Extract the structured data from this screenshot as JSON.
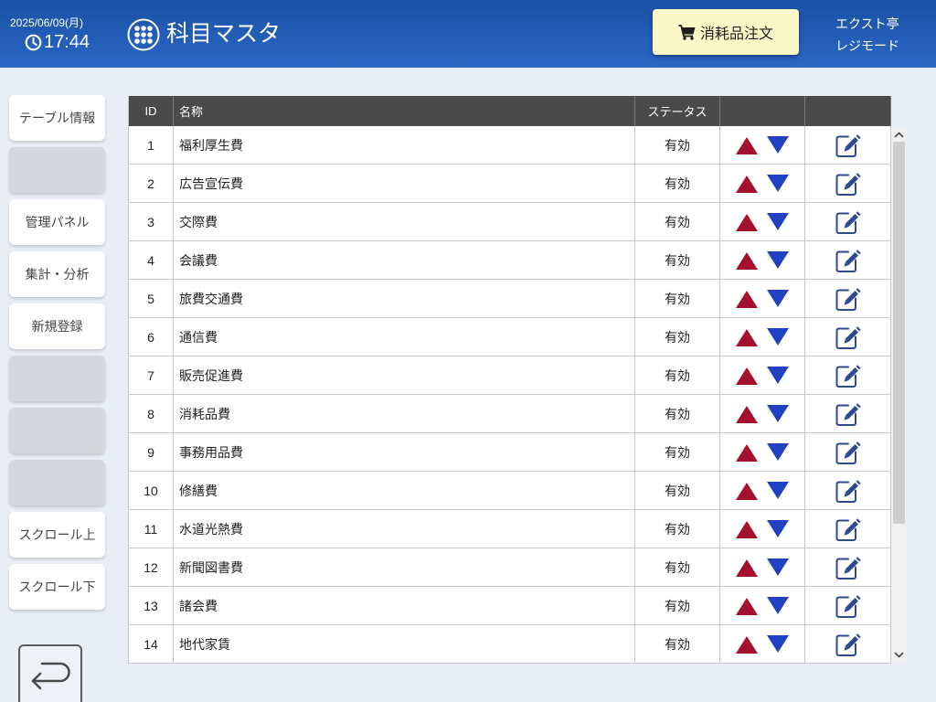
{
  "header": {
    "date": "2025/06/09(月)",
    "time": "17:44",
    "title": "科目マスタ",
    "order_button": {
      "label": "消耗品注文",
      "icon": "cart-icon"
    },
    "store_name": "エクスト亭",
    "mode": "レジモード",
    "clock_icon": "clock-icon",
    "menu_icon": "grid-menu-icon"
  },
  "sidebar": {
    "items": [
      {
        "label": "テーブル情報"
      },
      {
        "label": ""
      },
      {
        "label": "管理パネル"
      },
      {
        "label": "集計・分析"
      },
      {
        "label": "新規登録"
      },
      {
        "label": ""
      },
      {
        "label": ""
      },
      {
        "label": ""
      },
      {
        "label": "スクロール上"
      },
      {
        "label": "スクロール下"
      }
    ],
    "back_button_icon": "return-arrow-icon"
  },
  "table": {
    "columns": {
      "id": "ID",
      "name": "名称",
      "status": "ステータス"
    },
    "row_icons": {
      "move_up": "triangle-up-icon",
      "move_down": "triangle-down-icon",
      "edit": "edit-icon"
    },
    "rows": [
      {
        "id": "1",
        "name": "福利厚生費",
        "status": "有効"
      },
      {
        "id": "2",
        "name": "広告宣伝費",
        "status": "有効"
      },
      {
        "id": "3",
        "name": "交際費",
        "status": "有効"
      },
      {
        "id": "4",
        "name": "会議費",
        "status": "有効"
      },
      {
        "id": "5",
        "name": "旅費交通費",
        "status": "有効"
      },
      {
        "id": "6",
        "name": "通信費",
        "status": "有効"
      },
      {
        "id": "7",
        "name": "販売促進費",
        "status": "有効"
      },
      {
        "id": "8",
        "name": "消耗品費",
        "status": "有効"
      },
      {
        "id": "9",
        "name": "事務用品費",
        "status": "有効"
      },
      {
        "id": "10",
        "name": "修繕費",
        "status": "有効"
      },
      {
        "id": "11",
        "name": "水道光熱費",
        "status": "有効"
      },
      {
        "id": "12",
        "name": "新聞図書費",
        "status": "有効"
      },
      {
        "id": "13",
        "name": "諸会費",
        "status": "有効"
      },
      {
        "id": "14",
        "name": "地代家賃",
        "status": "有効"
      }
    ]
  },
  "scrollbar": {
    "up_icon": "chevron-up-icon",
    "down_icon": "chevron-down-icon"
  },
  "colors": {
    "header_background": "#2360b8",
    "order_button_background": "#fbf7c6",
    "page_background": "#e8eef4",
    "table_header_background": "#4a4a4a",
    "move_up_icon": "#a3112c",
    "move_down_icon": "#2141c2",
    "edit_icon": "#2e4a8c"
  }
}
